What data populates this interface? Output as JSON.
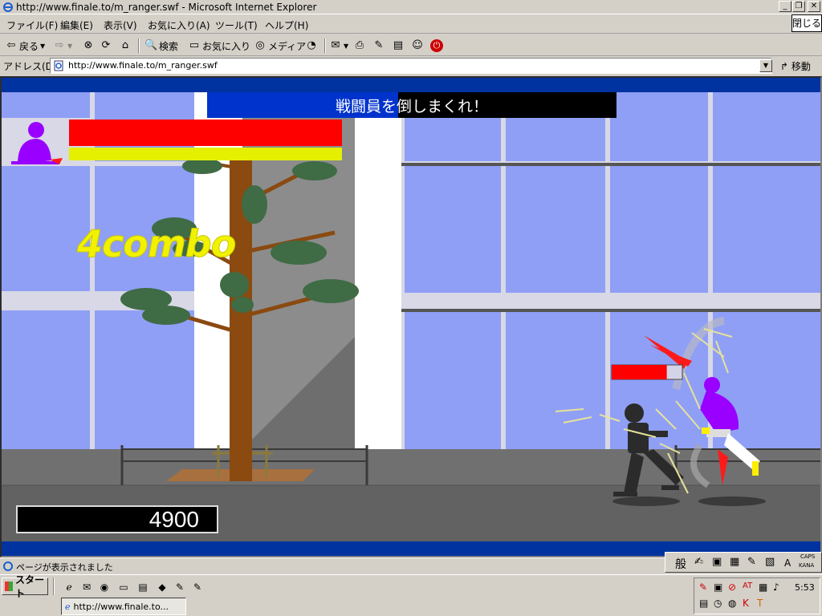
{
  "window": {
    "title": "http://www.finale.to/m_ranger.swf - Microsoft Internet Explorer",
    "close_tab_label": "閉じる"
  },
  "menu": [
    "ファイル(F)",
    "編集(E)",
    "表示(V)",
    "お気に入り(A)",
    "ツール(T)",
    "ヘルプ(H)"
  ],
  "toolbar": {
    "back": "戻る",
    "search": "検索",
    "favorites": "お気に入り",
    "media": "メディア"
  },
  "address": {
    "label": "アドレス(D)",
    "url": "http://www.finale.to/m_ranger.swf",
    "go": "移動"
  },
  "game": {
    "mission_text": "戦闘員を倒しまくれ！",
    "combo_text": "4combo",
    "score": "4900",
    "player_health": 1.0,
    "player_special": 1.0,
    "enemy_health": 0.78,
    "colors": {
      "health_red": "#ff0000",
      "special_yellow": "#e4f000",
      "player_purple": "#9900ff",
      "sky_blue": "#8fa0f5",
      "ground_gray": "#6b6b6b",
      "banner_blue": "#0033cc"
    }
  },
  "status": {
    "text": "ページが表示されました"
  },
  "ime": {
    "mode": "般",
    "caps": "CAPS",
    "kana": "KANA"
  },
  "taskbar": {
    "start_label": "スタート",
    "task_ie_label": "http://www.finale.to...",
    "clock": "5:53"
  }
}
